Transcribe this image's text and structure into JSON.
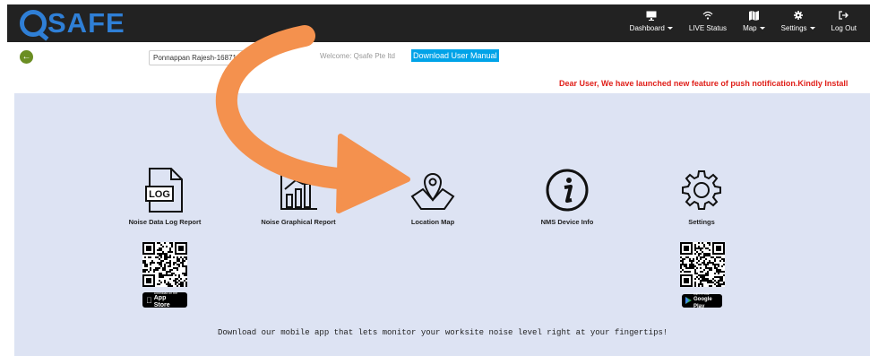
{
  "brand": {
    "logo_text": "SAFE",
    "logo_accent": "#2f7fd6"
  },
  "nav": {
    "items": [
      {
        "label": "Dashboard",
        "icon": "monitor-icon",
        "dropdown": true
      },
      {
        "label": "LIVE Status",
        "icon": "wifi-icon",
        "dropdown": false
      },
      {
        "label": "Map",
        "icon": "map-icon",
        "dropdown": true
      },
      {
        "label": "Settings",
        "icon": "gear-icon",
        "dropdown": true
      },
      {
        "label": "Log Out",
        "icon": "logout-icon",
        "dropdown": false
      }
    ]
  },
  "toolbar": {
    "user_select_value": "Ponnappan Rajesh-16871",
    "welcome_text": "Welcome: Qsafe Pte ltd",
    "manual_button": "Download User Manual"
  },
  "notice": "Dear User, We have launched new feature of push notification.Kindly Install",
  "tiles": [
    {
      "label": "Noise Data Log Report",
      "icon": "log-file-icon"
    },
    {
      "label": "Noise Graphical Report",
      "icon": "bar-chart-icon"
    },
    {
      "label": "Location Map",
      "icon": "map-pin-icon"
    },
    {
      "label": "NMS Device Info",
      "icon": "info-icon"
    },
    {
      "label": "Settings",
      "icon": "gear-icon"
    }
  ],
  "apps": {
    "app_store_top": "Download on the",
    "app_store_main": "App Store",
    "google_play_top": "GET IT ON",
    "google_play_main": "Google Play"
  },
  "download_text": "Download our mobile app that lets monitor your worksite noise level right at your fingertips!",
  "colors": {
    "topbar": "#222222",
    "panel": "#dde3f3",
    "notice": "#e0201a",
    "manual_button": "#00a3e8",
    "back_button": "#6b8e23",
    "arrow": "#f4914e"
  }
}
